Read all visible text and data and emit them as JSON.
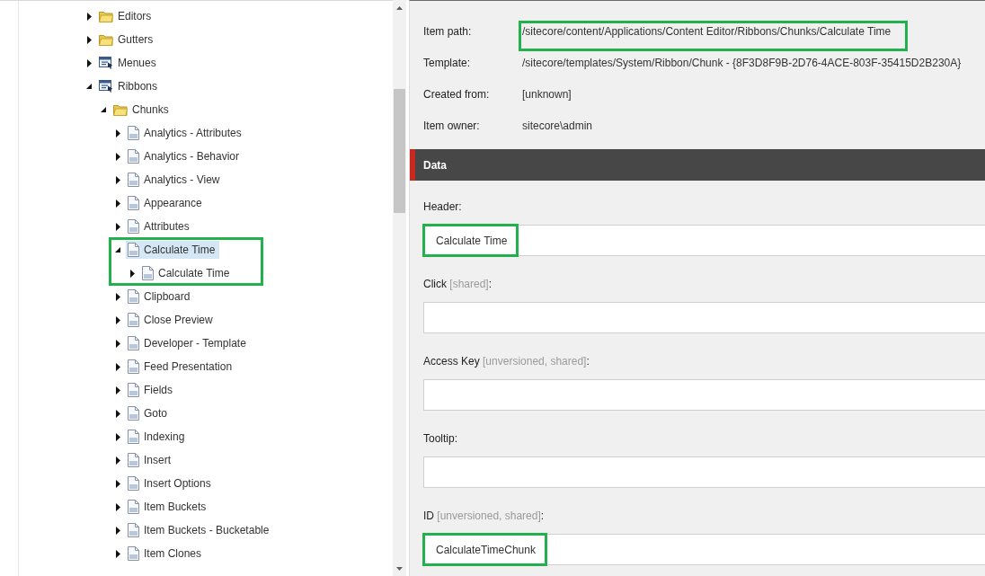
{
  "tree": [
    {
      "label": "Editors",
      "kind": "folder",
      "expanded": false,
      "selected": false,
      "highlighted": false
    },
    {
      "label": "Gutters",
      "kind": "folder",
      "expanded": false,
      "selected": false,
      "highlighted": false
    },
    {
      "label": "Menues",
      "kind": "menu",
      "expanded": false,
      "selected": false,
      "highlighted": false
    },
    {
      "label": "Ribbons",
      "kind": "menu",
      "expanded": true,
      "selected": false,
      "highlighted": false,
      "children": [
        {
          "label": "Chunks",
          "kind": "folder",
          "expanded": true,
          "selected": false,
          "highlighted": false,
          "children": [
            {
              "label": "Analytics - Attributes",
              "kind": "item",
              "expanded": false,
              "selected": false,
              "highlighted": false
            },
            {
              "label": "Analytics - Behavior",
              "kind": "item",
              "expanded": false,
              "selected": false,
              "highlighted": false
            },
            {
              "label": "Analytics - View",
              "kind": "item",
              "expanded": false,
              "selected": false,
              "highlighted": false
            },
            {
              "label": "Appearance",
              "kind": "item",
              "expanded": false,
              "selected": false,
              "highlighted": false
            },
            {
              "label": "Attributes",
              "kind": "item",
              "expanded": false,
              "selected": false,
              "highlighted": false
            },
            {
              "label": "Calculate Time",
              "kind": "item",
              "expanded": true,
              "selected": true,
              "highlighted": true,
              "children": [
                {
                  "label": "Calculate Time",
                  "kind": "item",
                  "expanded": false,
                  "selected": false,
                  "highlighted": false
                }
              ]
            },
            {
              "label": "Clipboard",
              "kind": "item",
              "expanded": false,
              "selected": false,
              "highlighted": false
            },
            {
              "label": "Close Preview",
              "kind": "item",
              "expanded": false,
              "selected": false,
              "highlighted": false
            },
            {
              "label": "Developer - Template",
              "kind": "item",
              "expanded": false,
              "selected": false,
              "highlighted": false
            },
            {
              "label": "Feed Presentation",
              "kind": "item",
              "expanded": false,
              "selected": false,
              "highlighted": false
            },
            {
              "label": "Fields",
              "kind": "item",
              "expanded": false,
              "selected": false,
              "highlighted": false
            },
            {
              "label": "Goto",
              "kind": "item",
              "expanded": false,
              "selected": false,
              "highlighted": false
            },
            {
              "label": "Indexing",
              "kind": "item",
              "expanded": false,
              "selected": false,
              "highlighted": false
            },
            {
              "label": "Insert",
              "kind": "item",
              "expanded": false,
              "selected": false,
              "highlighted": false
            },
            {
              "label": "Insert Options",
              "kind": "item",
              "expanded": false,
              "selected": false,
              "highlighted": false
            },
            {
              "label": "Item Buckets",
              "kind": "item",
              "expanded": false,
              "selected": false,
              "highlighted": false
            },
            {
              "label": "Item Buckets - Bucketable",
              "kind": "item",
              "expanded": false,
              "selected": false,
              "highlighted": false
            },
            {
              "label": "Item Clones",
              "kind": "item",
              "expanded": false,
              "selected": false,
              "highlighted": false
            }
          ]
        }
      ]
    }
  ],
  "item_info": [
    {
      "label": "Item path:",
      "value": "/sitecore/content/Applications/Content Editor/Ribbons/Chunks/Calculate Time",
      "highlighted": true
    },
    {
      "label": "Template:",
      "value": "/sitecore/templates/System/Ribbon/Chunk - {8F3D8F9B-2D76-4ACE-803F-35415D2B230A}",
      "highlighted": false
    },
    {
      "label": "Created from:",
      "value": "[unknown]",
      "highlighted": false
    },
    {
      "label": "Item owner:",
      "value": "sitecore\\admin",
      "highlighted": false
    }
  ],
  "section": {
    "title": "Data"
  },
  "fields": [
    {
      "label": "Header:",
      "value": "Calculate Time",
      "highlighted": true
    },
    {
      "label": "Click *[shared]*:",
      "highlighted": false
    },
    {
      "label": "Access Key *[unversioned, shared]*:",
      "highlighted": false
    },
    {
      "label": "Tooltip:",
      "highlighted": false
    },
    {
      "label": "ID *[unversioned, shared]*:",
      "value": "CalculateTimeChunk",
      "highlighted": true
    }
  ]
}
